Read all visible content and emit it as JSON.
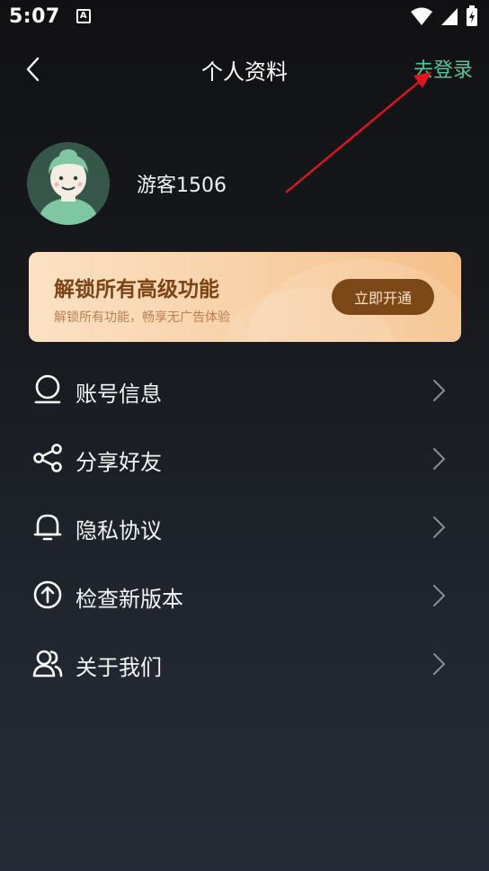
{
  "status_bar": {
    "time": "5:07",
    "a_icon": "A",
    "icons": [
      "wifi-icon",
      "signal-icon",
      "battery-icon"
    ]
  },
  "nav": {
    "title": "个人资料",
    "login_label": "去登录",
    "back_icon": "chevron-left-icon"
  },
  "profile": {
    "username": "游客1506",
    "avatar_icon": "avatar"
  },
  "vip": {
    "title": "解锁所有高级功能",
    "subtitle": "解锁所有功能，畅享无广告体验",
    "button_label": "立即开通"
  },
  "menu": [
    {
      "label": "账号信息",
      "icon": "user-icon"
    },
    {
      "label": "分享好友",
      "icon": "share-icon"
    },
    {
      "label": "隐私协议",
      "icon": "bell-icon"
    },
    {
      "label": "检查新版本",
      "icon": "upload-icon"
    },
    {
      "label": "关于我们",
      "icon": "users-icon"
    }
  ],
  "colors": {
    "accent_green": "#52c79a",
    "annotation_red": "#e0161f",
    "vip_brown": "#7c4818"
  }
}
